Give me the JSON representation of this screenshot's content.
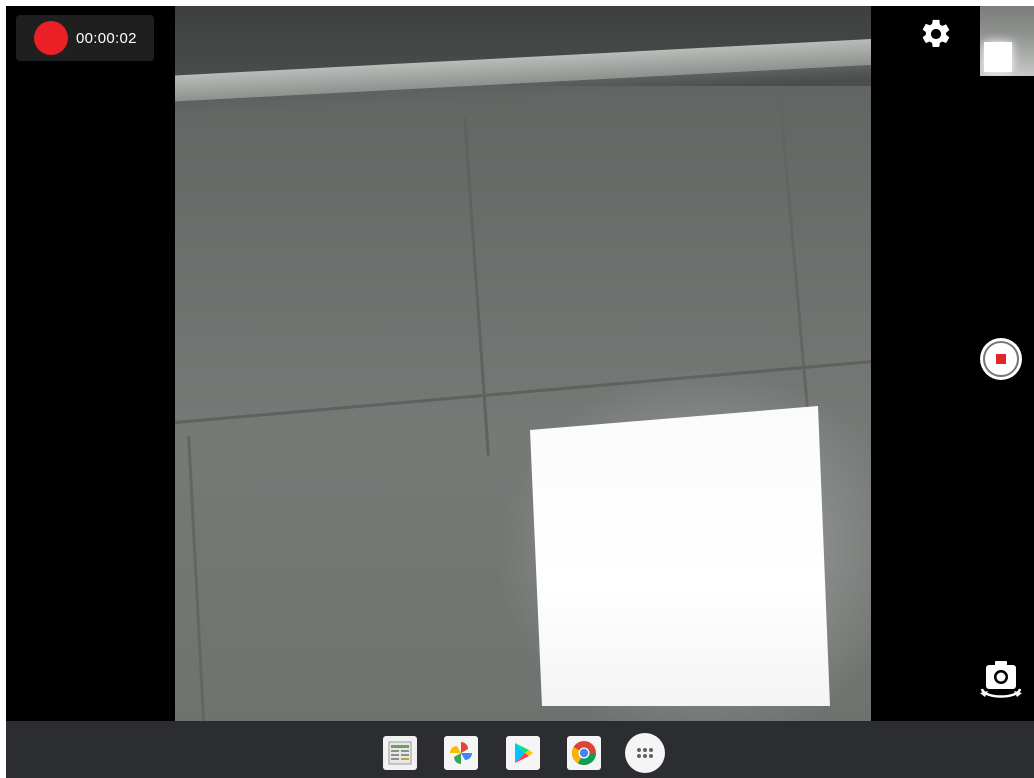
{
  "recording": {
    "elapsed": "00:00:02",
    "indicator_color": "#ea2026"
  },
  "controls": {
    "settings_icon": "gear-icon",
    "thumbnail_icon": "last-capture-thumbnail",
    "stop_icon": "stop-record-icon",
    "switch_camera_icon": "switch-camera-icon"
  },
  "shelf": {
    "apps": [
      {
        "id": "sheets",
        "icon": "sheets-app-icon"
      },
      {
        "id": "photos",
        "icon": "photos-app-icon"
      },
      {
        "id": "play-store",
        "icon": "play-store-app-icon"
      },
      {
        "id": "chrome",
        "icon": "chrome-app-icon"
      },
      {
        "id": "launcher",
        "icon": "app-launcher-icon"
      }
    ]
  },
  "colors": {
    "accent_red": "#e0262c",
    "shelf_bg": "#2b2d30"
  }
}
